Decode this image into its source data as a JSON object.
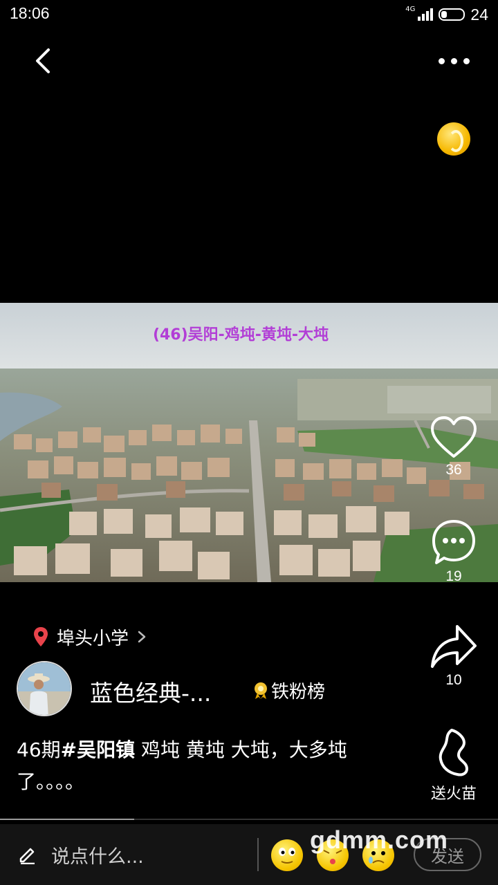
{
  "status_bar": {
    "time": "18:06",
    "network": "4G",
    "battery": "24"
  },
  "video": {
    "title": "(46)吴阳-鸡坉-黄坉-大坉"
  },
  "actions": {
    "likes": "36",
    "comments": "19",
    "shares": "10",
    "send_fire_label": "送火苗"
  },
  "post": {
    "location": "埠头小学",
    "author_name": "蓝色经典-...",
    "fans_badge": "铁粉榜",
    "caption_prefix": "46期",
    "caption_tag": "#吴阳镇",
    "caption_rest": " 鸡坉 黄坉 大坉，大多坉了。。。。"
  },
  "progress": {
    "fraction": 0.27
  },
  "bottom_bar": {
    "comment_placeholder": "说点什么...",
    "send_label": "发送"
  },
  "watermark": "gdmm.com",
  "colors": {
    "background": "#000000",
    "title_purple": "#b23ed6",
    "location_pin": "#e8434b",
    "coin": "#f6b800"
  }
}
